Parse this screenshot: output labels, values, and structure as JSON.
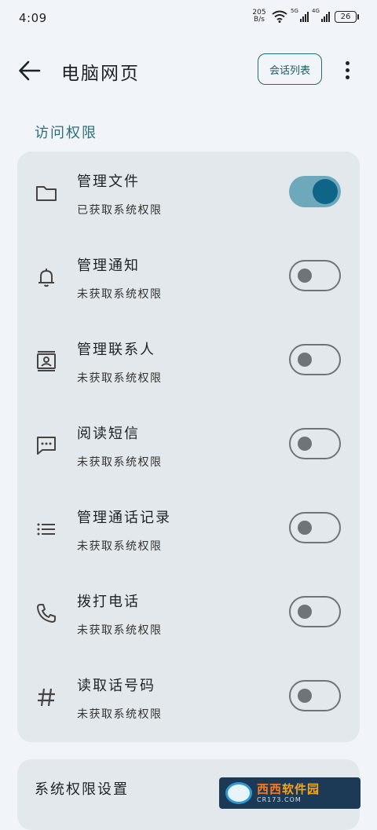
{
  "status_bar": {
    "time": "4:09",
    "net_speed_value": "205",
    "net_speed_unit": "B/s",
    "signal1_label": "5G",
    "signal2_label": "4G",
    "battery": "26"
  },
  "app_bar": {
    "title": "电脑网页",
    "session_button": "会话列表"
  },
  "section_title": "访问权限",
  "permissions": [
    {
      "title": "管理文件",
      "status": "已获取系统权限",
      "icon": "folder-icon",
      "enabled": true
    },
    {
      "title": "管理通知",
      "status": "未获取系统权限",
      "icon": "bell-icon",
      "enabled": false
    },
    {
      "title": "管理联系人",
      "status": "未获取系统权限",
      "icon": "contact-card-icon",
      "enabled": false
    },
    {
      "title": "阅读短信",
      "status": "未获取系统权限",
      "icon": "message-icon",
      "enabled": false
    },
    {
      "title": "管理通话记录",
      "status": "未获取系统权限",
      "icon": "list-icon",
      "enabled": false
    },
    {
      "title": "拨打电话",
      "status": "未获取系统权限",
      "icon": "phone-icon",
      "enabled": false
    },
    {
      "title": "读取话号码",
      "status": "未获取系统权限",
      "icon": "hash-icon",
      "enabled": false
    }
  ],
  "system_settings_label": "系统权限设置",
  "colors": {
    "accent": "#0e6587",
    "section_title": "#2a6f7a",
    "card": "#e3e8ec",
    "background": "#f1f5f9"
  },
  "watermark": {
    "main_a": "西西",
    "main_b": "软件园",
    "sub": "CR173.COM"
  }
}
